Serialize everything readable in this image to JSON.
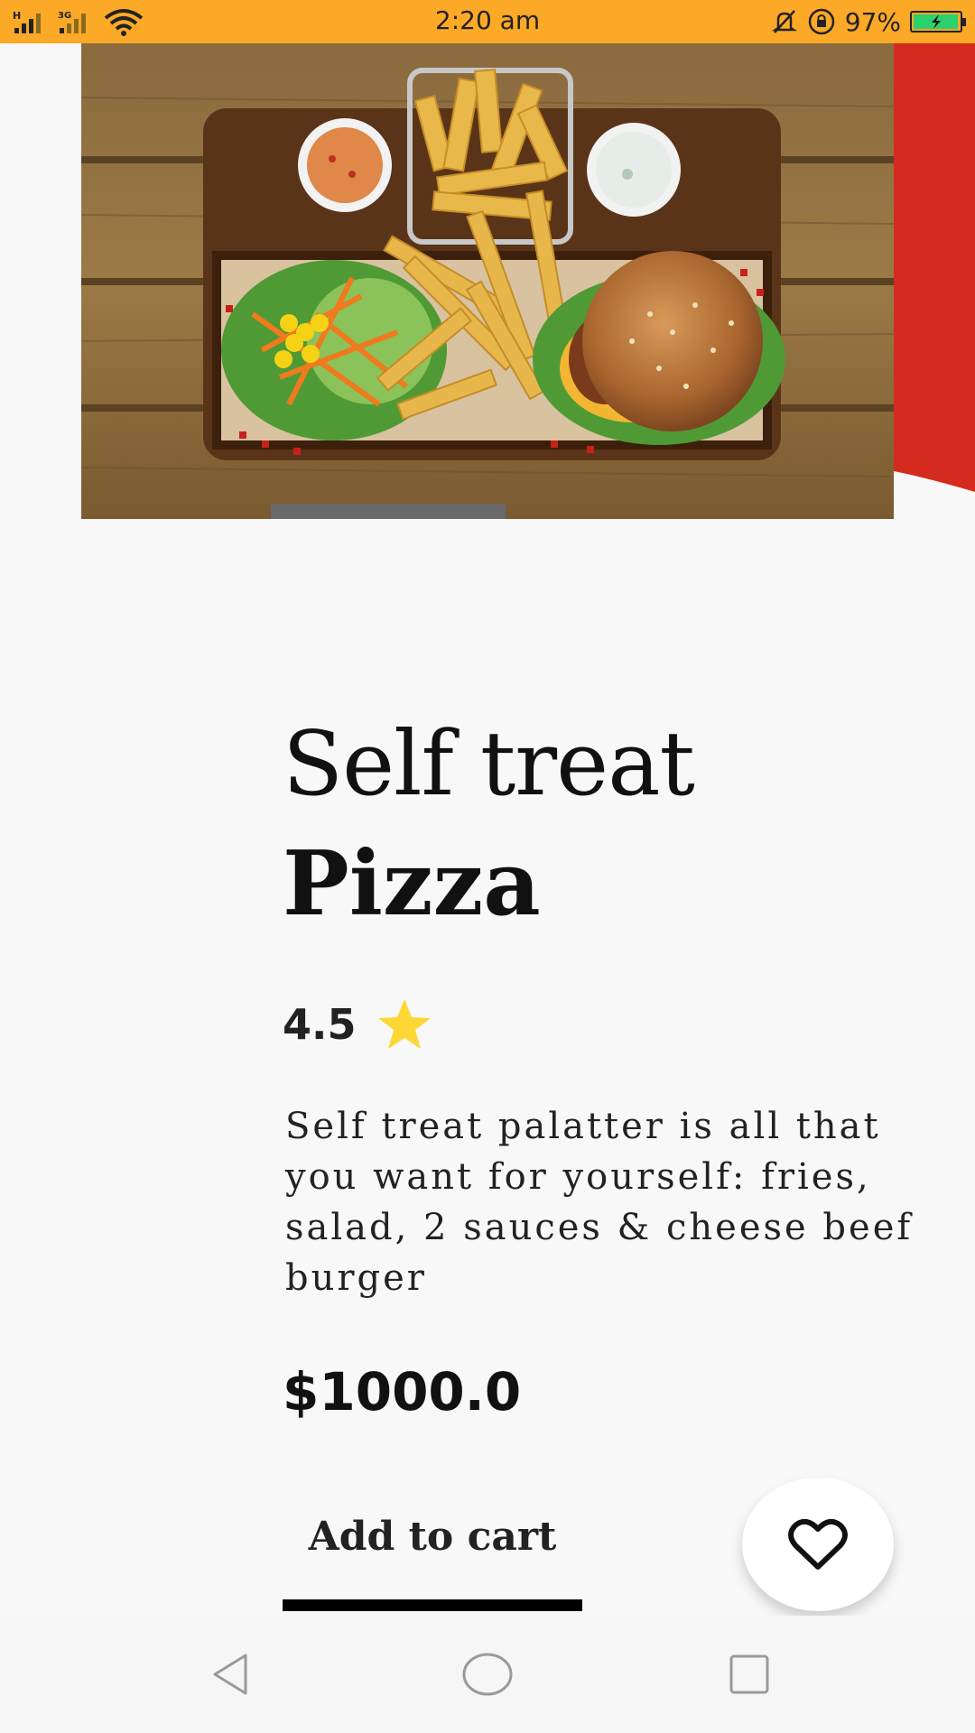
{
  "status_bar": {
    "time": "2:20 am",
    "battery_level": "97%",
    "battery_fraction": 0.97,
    "signal_label": "3G",
    "icons": [
      "signal-h-icon",
      "signal-3g-icon",
      "wifi-icon",
      "mute-bell-icon",
      "rotation-lock-icon",
      "battery-charging-icon"
    ],
    "bg_color": "#fca927"
  },
  "hero": {
    "image_subject": "burger-fries-salad-platter",
    "accent_color": "#d52b1e"
  },
  "product": {
    "title_light": "Self treat",
    "title_bold": "Pizza",
    "rating": "4.5",
    "description": "Self treat palatter is all that you want for yourself: fries, salad, 2 sauces & cheese beef burger",
    "price": "$1000.0",
    "star_color": "#fdd835"
  },
  "actions": {
    "add_to_cart_label": "Add to cart",
    "favorite_icon": "heart-outline-icon"
  },
  "nav_bar": {
    "items": [
      "back-icon",
      "home-icon",
      "recents-icon"
    ]
  }
}
